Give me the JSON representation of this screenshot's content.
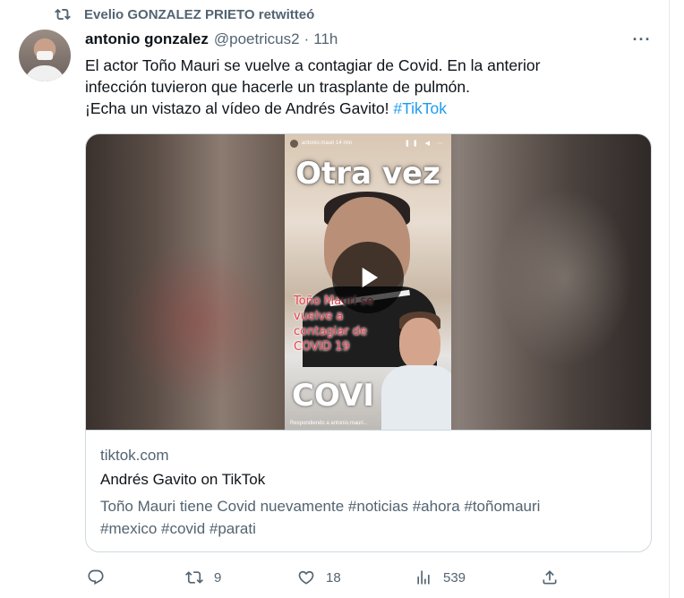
{
  "retweet": {
    "icon": "retweet-icon",
    "text": "Evelio GONZALEZ PRIETO retwitteó"
  },
  "tweet": {
    "author_name": "antonio gonzalez",
    "handle": "@poetricus2",
    "separator": "·",
    "time": "11h",
    "more_icon": "more-icon",
    "more_glyph": "···",
    "text_line1": "El actor Toño Mauri se vuelve a contagiar de Covid. En la anterior",
    "text_line2": "infección tuvieron que hacerle un trasplante de pulmón.",
    "text_line3": "¡Echa un vistazo al vídeo de Andrés Gavito!",
    "hashtag": "#TikTok"
  },
  "card": {
    "video": {
      "account": "antonio.mauri",
      "age": "14 min",
      "title": "Otra vez",
      "overlay_text": "Toño Mauri se vuelve a contagiar de COVID 19",
      "bottom_text": "COVI",
      "reply_text": "Respondiendo a antonio.mauri...",
      "play_icon": "play-icon"
    },
    "domain": "tiktok.com",
    "title": "Andrés Gavito on TikTok",
    "description_text": "Toño Mauri tiene Covid nuevamente",
    "description_tags_1": "#noticias #ahora #toñomauri",
    "description_tags_2": "#mexico #covid #parati"
  },
  "actions": {
    "reply": {
      "icon": "reply-icon",
      "count": ""
    },
    "retweet": {
      "icon": "retweet-icon",
      "count": "9"
    },
    "like": {
      "icon": "heart-icon",
      "count": "18"
    },
    "views": {
      "icon": "views-icon",
      "count": "539"
    },
    "share": {
      "icon": "share-icon",
      "count": ""
    }
  },
  "colors": {
    "text": "#0f1419",
    "secondary": "#536471",
    "link": "#1d9bf0",
    "border": "#cfd9de"
  }
}
